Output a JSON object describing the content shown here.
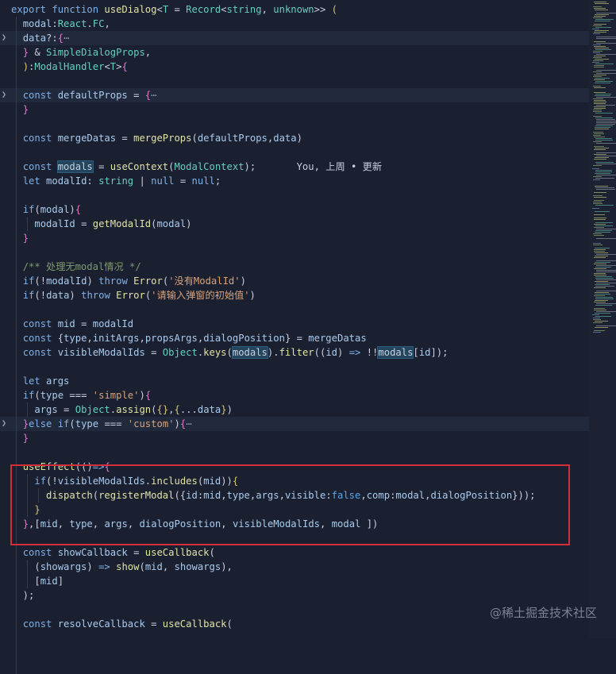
{
  "editor": {
    "lines": [
      {
        "tokens": [
          [
            "kw",
            "export "
          ],
          [
            "kw",
            "function "
          ],
          [
            "fn",
            "useDialog"
          ],
          [
            "op",
            "<"
          ],
          [
            "type",
            "T"
          ],
          [
            "op",
            " = "
          ],
          [
            "type",
            "Record"
          ],
          [
            "op",
            "<"
          ],
          [
            "type",
            "string"
          ],
          [
            "op",
            ", "
          ],
          [
            "type",
            "unknown"
          ],
          [
            "op",
            ">> "
          ],
          [
            "bracket",
            "("
          ]
        ]
      },
      {
        "tokens": [
          [
            "op",
            "  "
          ],
          [
            "var",
            "modal"
          ],
          [
            "op",
            ":"
          ],
          [
            "type",
            "React"
          ],
          [
            "op",
            "."
          ],
          [
            "type",
            "FC"
          ],
          [
            "op",
            ","
          ]
        ]
      },
      {
        "fold": true,
        "highlight": true,
        "tokens": [
          [
            "op",
            "  "
          ],
          [
            "var",
            "data"
          ],
          [
            "op",
            "?:"
          ],
          [
            "bracket2",
            "{"
          ],
          [
            "fold",
            "⋯"
          ]
        ]
      },
      {
        "tokens": [
          [
            "op",
            "  "
          ],
          [
            "bracket2",
            "}"
          ],
          [
            "op",
            " & "
          ],
          [
            "type",
            "SimpleDialogProps"
          ],
          [
            "op",
            ","
          ]
        ]
      },
      {
        "tokens": [
          [
            "op",
            "  "
          ],
          [
            "bracket",
            ")"
          ],
          [
            "op",
            ":"
          ],
          [
            "type",
            "ModalHandler"
          ],
          [
            "op",
            "<"
          ],
          [
            "type",
            "T"
          ],
          [
            "op",
            ">"
          ],
          [
            "bracket2",
            "{"
          ]
        ]
      },
      {
        "tokens": []
      },
      {
        "fold": true,
        "highlight": true,
        "tokens": [
          [
            "op",
            "  "
          ],
          [
            "kw",
            "const "
          ],
          [
            "var",
            "defaultProps"
          ],
          [
            "op",
            " = "
          ],
          [
            "bracket2",
            "{"
          ],
          [
            "fold",
            "⋯"
          ]
        ]
      },
      {
        "tokens": [
          [
            "op",
            "  "
          ],
          [
            "bracket2",
            "}"
          ]
        ]
      },
      {
        "tokens": []
      },
      {
        "tokens": [
          [
            "op",
            "  "
          ],
          [
            "kw",
            "const "
          ],
          [
            "var",
            "mergeDatas"
          ],
          [
            "op",
            " = "
          ],
          [
            "fn",
            "mergeProps"
          ],
          [
            "op",
            "("
          ],
          [
            "var",
            "defaultProps"
          ],
          [
            "op",
            ","
          ],
          [
            "var",
            "data"
          ],
          [
            "op",
            ")"
          ]
        ]
      },
      {
        "tokens": []
      },
      {
        "tokens": [
          [
            "op",
            "  "
          ],
          [
            "kw",
            "const "
          ],
          [
            "match",
            "modals"
          ],
          [
            "op",
            " = "
          ],
          [
            "fn",
            "useContext"
          ],
          [
            "op",
            "("
          ],
          [
            "type",
            "ModalContext"
          ],
          [
            "op",
            ");"
          ],
          [
            "blame",
            "       You, 上周 • 更新"
          ]
        ]
      },
      {
        "tokens": [
          [
            "op",
            "  "
          ],
          [
            "kw",
            "let "
          ],
          [
            "var",
            "modalId"
          ],
          [
            "op",
            ": "
          ],
          [
            "type",
            "string"
          ],
          [
            "op",
            " | "
          ],
          [
            "kw",
            "null"
          ],
          [
            "op",
            " = "
          ],
          [
            "kw",
            "null"
          ],
          [
            "op",
            ";"
          ]
        ]
      },
      {
        "tokens": []
      },
      {
        "tokens": [
          [
            "op",
            "  "
          ],
          [
            "kw",
            "if"
          ],
          [
            "op",
            "("
          ],
          [
            "var",
            "modal"
          ],
          [
            "op",
            ")"
          ],
          [
            "bracket2",
            "{"
          ]
        ]
      },
      {
        "tokens": [
          [
            "op",
            "    "
          ],
          [
            "var",
            "modalId"
          ],
          [
            "op",
            " = "
          ],
          [
            "fn",
            "getModalId"
          ],
          [
            "op",
            "("
          ],
          [
            "var",
            "modal"
          ],
          [
            "op",
            ")"
          ]
        ]
      },
      {
        "tokens": [
          [
            "op",
            "  "
          ],
          [
            "bracket2",
            "}"
          ]
        ]
      },
      {
        "tokens": []
      },
      {
        "tokens": [
          [
            "op",
            "  "
          ],
          [
            "com",
            "/** 处理无modal情况 */"
          ]
        ]
      },
      {
        "tokens": [
          [
            "op",
            "  "
          ],
          [
            "kw",
            "if"
          ],
          [
            "op",
            "(!"
          ],
          [
            "var",
            "modalId"
          ],
          [
            "op",
            ") "
          ],
          [
            "kw",
            "throw "
          ],
          [
            "fn",
            "Error"
          ],
          [
            "op",
            "("
          ],
          [
            "str",
            "'没有ModalId'"
          ],
          [
            "op",
            ")"
          ]
        ]
      },
      {
        "tokens": [
          [
            "op",
            "  "
          ],
          [
            "kw",
            "if"
          ],
          [
            "op",
            "(!"
          ],
          [
            "var",
            "data"
          ],
          [
            "op",
            ") "
          ],
          [
            "kw",
            "throw "
          ],
          [
            "fn",
            "Error"
          ],
          [
            "op",
            "("
          ],
          [
            "str",
            "'请输入弹窗的初始值'"
          ],
          [
            "op",
            ")"
          ]
        ]
      },
      {
        "tokens": []
      },
      {
        "tokens": [
          [
            "op",
            "  "
          ],
          [
            "kw",
            "const "
          ],
          [
            "var",
            "mid"
          ],
          [
            "op",
            " = "
          ],
          [
            "var",
            "modalId"
          ]
        ]
      },
      {
        "tokens": [
          [
            "op",
            "  "
          ],
          [
            "kw",
            "const "
          ],
          [
            "op",
            "{"
          ],
          [
            "var",
            "type"
          ],
          [
            "op",
            ","
          ],
          [
            "var",
            "initArgs"
          ],
          [
            "op",
            ","
          ],
          [
            "var",
            "propsArgs"
          ],
          [
            "op",
            ","
          ],
          [
            "var",
            "dialogPosition"
          ],
          [
            "op",
            "} = "
          ],
          [
            "var",
            "mergeDatas"
          ]
        ]
      },
      {
        "tokens": [
          [
            "op",
            "  "
          ],
          [
            "kw",
            "const "
          ],
          [
            "var",
            "visibleModalIds"
          ],
          [
            "op",
            " = "
          ],
          [
            "type",
            "Object"
          ],
          [
            "op",
            "."
          ],
          [
            "fn",
            "keys"
          ],
          [
            "op",
            "("
          ],
          [
            "match",
            "modals"
          ],
          [
            "op",
            ")."
          ],
          [
            "fn",
            "filter"
          ],
          [
            "op",
            "(("
          ],
          [
            "var",
            "id"
          ],
          [
            "op",
            ") "
          ],
          [
            "kw",
            "=>"
          ],
          [
            "op",
            " !!"
          ],
          [
            "match",
            "modals"
          ],
          [
            "op",
            "["
          ],
          [
            "var",
            "id"
          ],
          [
            "op",
            "]);"
          ]
        ]
      },
      {
        "tokens": []
      },
      {
        "tokens": [
          [
            "op",
            "  "
          ],
          [
            "kw",
            "let "
          ],
          [
            "var",
            "args"
          ]
        ]
      },
      {
        "tokens": [
          [
            "op",
            "  "
          ],
          [
            "kw",
            "if"
          ],
          [
            "op",
            "("
          ],
          [
            "var",
            "type"
          ],
          [
            "op",
            " === "
          ],
          [
            "str",
            "'simple'"
          ],
          [
            "op",
            ")"
          ],
          [
            "bracket2",
            "{"
          ]
        ]
      },
      {
        "tokens": [
          [
            "op",
            "    "
          ],
          [
            "var",
            "args"
          ],
          [
            "op",
            " = "
          ],
          [
            "type",
            "Object"
          ],
          [
            "op",
            "."
          ],
          [
            "fn",
            "assign"
          ],
          [
            "op",
            "("
          ],
          [
            "bracket",
            "{}"
          ],
          [
            "op",
            ","
          ],
          [
            "bracket",
            "{"
          ],
          [
            "op",
            "..."
          ],
          [
            "var",
            "data"
          ],
          [
            "bracket",
            "}"
          ],
          [
            "op",
            ")"
          ]
        ]
      },
      {
        "fold": true,
        "highlight": true,
        "tokens": [
          [
            "op",
            "  "
          ],
          [
            "bracket2",
            "}"
          ],
          [
            "kw",
            "else if"
          ],
          [
            "op",
            "("
          ],
          [
            "var",
            "type"
          ],
          [
            "op",
            " === "
          ],
          [
            "str",
            "'custom'"
          ],
          [
            "op",
            ")"
          ],
          [
            "bracket2",
            "{"
          ],
          [
            "fold",
            "⋯"
          ]
        ]
      },
      {
        "tokens": [
          [
            "op",
            "  "
          ],
          [
            "bracket2",
            "}"
          ]
        ]
      },
      {
        "tokens": []
      },
      {
        "tokens": [
          [
            "op",
            "  "
          ],
          [
            "fn",
            "useEffect"
          ],
          [
            "op",
            "(()"
          ],
          [
            "kw",
            "=>"
          ],
          [
            "bracket2",
            "{"
          ]
        ]
      },
      {
        "tokens": [
          [
            "op",
            "    "
          ],
          [
            "kw",
            "if"
          ],
          [
            "op",
            "(!"
          ],
          [
            "var",
            "visibleModalIds"
          ],
          [
            "op",
            "."
          ],
          [
            "fn",
            "includes"
          ],
          [
            "op",
            "("
          ],
          [
            "var",
            "mid"
          ],
          [
            "op",
            "))"
          ],
          [
            "bracket",
            "{"
          ]
        ]
      },
      {
        "tokens": [
          [
            "op",
            "      "
          ],
          [
            "fn",
            "dispatch"
          ],
          [
            "op",
            "("
          ],
          [
            "fn",
            "registerModal"
          ],
          [
            "op",
            "({"
          ],
          [
            "var",
            "id"
          ],
          [
            "op",
            ":"
          ],
          [
            "var",
            "mid"
          ],
          [
            "op",
            ","
          ],
          [
            "var",
            "type"
          ],
          [
            "op",
            ","
          ],
          [
            "var",
            "args"
          ],
          [
            "op",
            ","
          ],
          [
            "var",
            "visible"
          ],
          [
            "op",
            ":"
          ],
          [
            "bool",
            "false"
          ],
          [
            "op",
            ","
          ],
          [
            "var",
            "comp"
          ],
          [
            "op",
            ":"
          ],
          [
            "var",
            "modal"
          ],
          [
            "op",
            ","
          ],
          [
            "var",
            "dialogPosition"
          ],
          [
            "op",
            "}));"
          ]
        ]
      },
      {
        "tokens": [
          [
            "op",
            "    "
          ],
          [
            "bracket",
            "}"
          ]
        ]
      },
      {
        "tokens": [
          [
            "op",
            "  "
          ],
          [
            "bracket2",
            "}"
          ],
          [
            "op",
            ",["
          ],
          [
            "var",
            "mid"
          ],
          [
            "op",
            ", "
          ],
          [
            "var",
            "type"
          ],
          [
            "op",
            ", "
          ],
          [
            "var",
            "args"
          ],
          [
            "op",
            ", "
          ],
          [
            "var",
            "dialogPosition"
          ],
          [
            "op",
            ", "
          ],
          [
            "var",
            "visibleModalIds"
          ],
          [
            "op",
            ", "
          ],
          [
            "var",
            "modal"
          ],
          [
            "op",
            " ])"
          ]
        ]
      },
      {
        "tokens": []
      },
      {
        "tokens": [
          [
            "op",
            "  "
          ],
          [
            "kw",
            "const "
          ],
          [
            "var",
            "showCallback"
          ],
          [
            "op",
            " = "
          ],
          [
            "fn",
            "useCallback"
          ],
          [
            "op",
            "("
          ]
        ]
      },
      {
        "tokens": [
          [
            "op",
            "    ("
          ],
          [
            "var",
            "showargs"
          ],
          [
            "op",
            ") "
          ],
          [
            "kw",
            "=>"
          ],
          [
            "op",
            " "
          ],
          [
            "fn",
            "show"
          ],
          [
            "op",
            "("
          ],
          [
            "var",
            "mid"
          ],
          [
            "op",
            ", "
          ],
          [
            "var",
            "showargs"
          ],
          [
            "op",
            "),"
          ]
        ]
      },
      {
        "tokens": [
          [
            "op",
            "    ["
          ],
          [
            "var",
            "mid"
          ],
          [
            "op",
            "]"
          ]
        ]
      },
      {
        "tokens": [
          [
            "op",
            "  );"
          ]
        ]
      },
      {
        "tokens": []
      },
      {
        "tokens": [
          [
            "op",
            "  "
          ],
          [
            "kw",
            "const "
          ],
          [
            "var",
            "resolveCallback"
          ],
          [
            "op",
            " = "
          ],
          [
            "fn",
            "useCallback"
          ],
          [
            "op",
            "("
          ]
        ]
      }
    ]
  },
  "colors": {
    "background": "#1b2030",
    "highlight_box": "#d12f3b",
    "keyword": "#7fb0e8",
    "function": "#dfe3a6",
    "type": "#63cfc0",
    "string": "#d9a27a",
    "comment": "#7f9a6f"
  },
  "watermark": {
    "text": "@稀土掘金技术社区"
  }
}
